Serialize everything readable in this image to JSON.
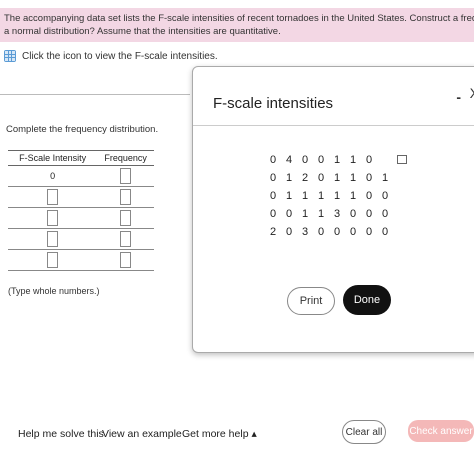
{
  "question": {
    "line1": "The accompanying data set lists the F-scale intensities of recent tornadoes in the United States. Construct a frequency distribution. Do the intensities appear to have",
    "line2": "a normal distribution? Assume that the intensities are quantitative."
  },
  "data_link": {
    "text": "Click the icon to view the F-scale intensities.",
    "icon": "grid-icon"
  },
  "table": {
    "instruction": "Complete the frequency distribution.",
    "headers": [
      "F-Scale Intensity",
      "Frequency"
    ],
    "first_intensity": "0",
    "note": "(Type whole numbers.)"
  },
  "popup": {
    "title": "F-scale intensities",
    "minimize": "-",
    "close": "X",
    "values": [
      [
        "0",
        "4",
        "0",
        "0",
        "1",
        "1",
        "0"
      ],
      [
        "0",
        "1",
        "2",
        "0",
        "1",
        "1",
        "0",
        "1"
      ],
      [
        "0",
        "1",
        "1",
        "1",
        "1",
        "1",
        "0",
        "0"
      ],
      [
        "0",
        "0",
        "1",
        "1",
        "3",
        "0",
        "0",
        "0"
      ],
      [
        "2",
        "0",
        "3",
        "0",
        "0",
        "0",
        "0",
        "0"
      ]
    ],
    "print": "Print",
    "done": "Done"
  },
  "bottom": {
    "help": "Help me solve this",
    "example": "View an example",
    "more_help": "Get more help ▴",
    "clear": "Clear all",
    "check": "Check answer"
  }
}
